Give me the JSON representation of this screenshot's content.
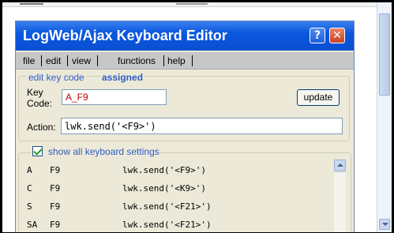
{
  "window": {
    "title": "LogWeb/Ajax Keyboard Editor",
    "help_glyph": "?",
    "close_glyph": "✕"
  },
  "menu": {
    "items": [
      "file",
      "edit",
      "view",
      "functions",
      "help"
    ]
  },
  "key_panel": {
    "tab_edit": "edit key code",
    "tab_assigned": "assigned",
    "keycode_label_line1": "Key",
    "keycode_label_line2": "Code:",
    "keycode_value": "A_F9",
    "update_label": "update",
    "action_label": "Action:",
    "action_value": "lwk.send('<F9>')"
  },
  "settings": {
    "show_all_label": "show all keyboard settings",
    "show_all_checked": true,
    "rows": [
      {
        "mod": "A",
        "key": "F9",
        "action": "lwk.send('<F9>')"
      },
      {
        "mod": "C",
        "key": "F9",
        "action": "lwk.send('<K9>')"
      },
      {
        "mod": "S",
        "key": "F9",
        "action": "lwk.send('<F21>')"
      },
      {
        "mod": "SA",
        "key": "F9",
        "action": "lwk.send('<F21>')"
      }
    ]
  },
  "colors": {
    "titlebar": "#0b57de",
    "link_blue": "#2f5cc4",
    "keycode_red": "#c00000",
    "panel_bg": "#ece9d8"
  },
  "icons": {
    "help": "help-icon",
    "close": "close-icon",
    "checkbox": "checkmark-icon",
    "scroll_up": "chevron-up-icon",
    "scroll_down": "chevron-down-icon"
  }
}
